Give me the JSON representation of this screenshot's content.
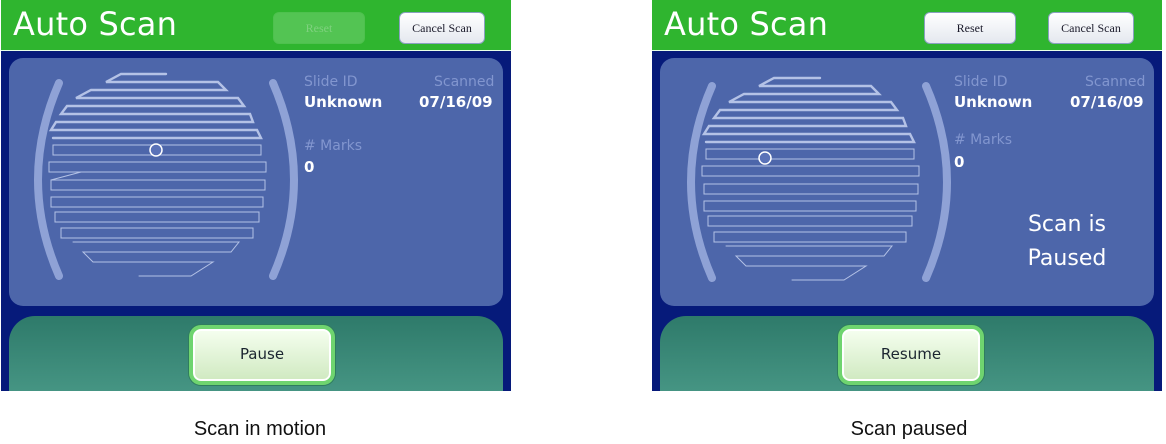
{
  "screens": [
    {
      "title": "Auto Scan",
      "reset_label": "Reset",
      "cancel_label": "Cancel Scan",
      "info": {
        "slide_id_label": "Slide ID",
        "slide_id_value": "Unknown",
        "scanned_label": "Scanned",
        "scanned_value": "07/16/09",
        "marks_label": "# Marks",
        "marks_value": "0"
      },
      "action_label": "Pause",
      "caption": "Scan in motion"
    },
    {
      "title": "Auto Scan",
      "reset_label": "Reset",
      "cancel_label": "Cancel Scan",
      "info": {
        "slide_id_label": "Slide ID",
        "slide_id_value": "Unknown",
        "scanned_label": "Scanned",
        "scanned_value": "07/16/09",
        "marks_label": "# Marks",
        "marks_value": "0"
      },
      "status_line1": "Scan is",
      "status_line2": "Paused",
      "action_label": "Resume",
      "caption": "Scan paused"
    }
  ],
  "colors": {
    "screen_bg": "#061a7a",
    "topbar": "#2fb52f",
    "panel": "#4d66aa",
    "bottom_area": "#3b8a7a",
    "button_border": "#6fd46f"
  },
  "states": {
    "left_reset_enabled": false,
    "right_reset_enabled": true
  }
}
